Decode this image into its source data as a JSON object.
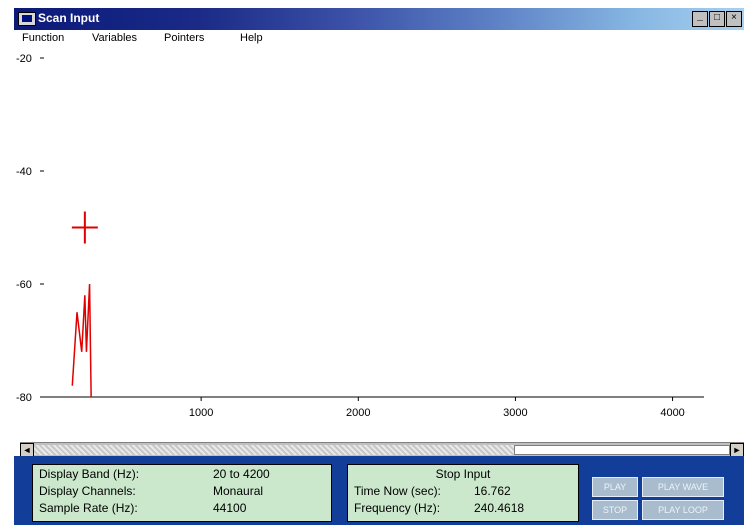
{
  "window": {
    "title": "Scan Input",
    "controls": [
      "_",
      "□",
      "×"
    ]
  },
  "menu": [
    "Function",
    "Variables",
    "Pointers",
    "Help"
  ],
  "chart_data": {
    "type": "line",
    "x_ticks": [
      "1000",
      "2000",
      "3000",
      "4000"
    ],
    "y_ticks": [
      "-20",
      "-40",
      "-60",
      "-80"
    ],
    "xlim": [
      0,
      4200
    ],
    "ylim": [
      -80,
      -20
    ],
    "series": [
      {
        "x": [
          180,
          210,
          240,
          260,
          270,
          290,
          300
        ],
        "y": [
          -78,
          -65,
          -72,
          -62,
          -72,
          -60,
          -80
        ]
      }
    ],
    "marker": {
      "x": 260,
      "y": -50
    }
  },
  "info_panel": [
    {
      "label": "Display Band (Hz):",
      "value": "20 to 4200"
    },
    {
      "label": "Display Channels:",
      "value": "Monaural"
    },
    {
      "label": "Sample Rate (Hz):",
      "value": "44100"
    }
  ],
  "status_panel": {
    "title": "Stop Input",
    "rows": [
      {
        "label": "Time Now (sec):",
        "value": "16.762"
      },
      {
        "label": "Frequency (Hz):",
        "value": "240.4618"
      }
    ]
  },
  "buttons": [
    "PLAY",
    "PLAY WAVE",
    "STOP",
    "PLAY LOOP"
  ],
  "colors": {
    "title_start": "#0b1a7a",
    "title_end": "#a8d0f0",
    "trace": "#e00000",
    "panel_bg": "#cbe8cc",
    "bottom_bg": "#123e9a"
  }
}
